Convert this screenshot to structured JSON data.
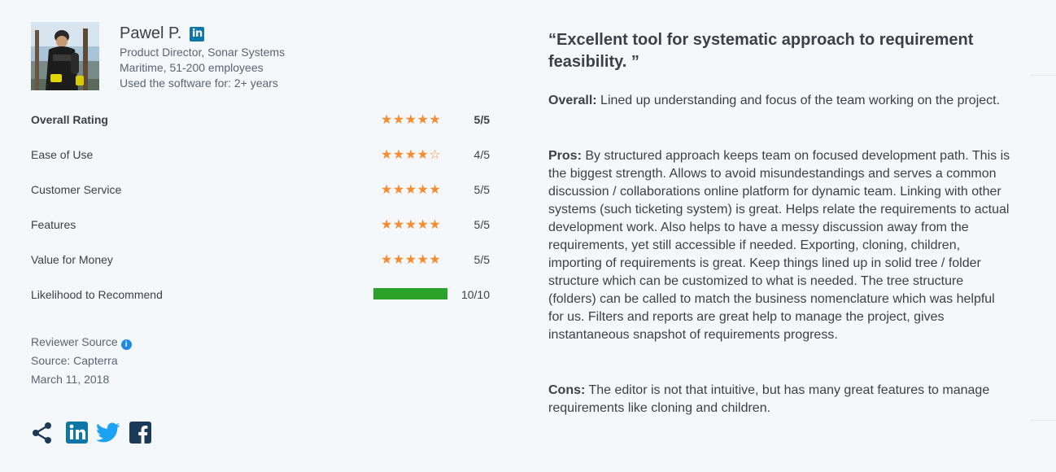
{
  "reviewer": {
    "name": "Pawel P.",
    "linkedin_badge": "in",
    "title": "Product Director, Sonar Systems",
    "industry": "Maritime, 51-200 employees",
    "usage": "Used the software for: 2+ years"
  },
  "ratings": [
    {
      "label": "Overall Rating",
      "score": "5/5",
      "stars": 5,
      "bold": true
    },
    {
      "label": "Ease of Use",
      "score": "4/5",
      "stars": 4
    },
    {
      "label": "Customer Service",
      "score": "5/5",
      "stars": 5
    },
    {
      "label": "Features",
      "score": "5/5",
      "stars": 5
    },
    {
      "label": "Value for Money",
      "score": "5/5",
      "stars": 5
    }
  ],
  "recommend": {
    "label": "Likelihood to Recommend",
    "score": "10/10",
    "fraction": 1.0,
    "bar_color": "#2ba32b"
  },
  "source": {
    "reviewer_source_label": "Reviewer Source",
    "source": "Source: Capterra",
    "date": "March 11, 2018"
  },
  "social_icons": [
    "share-icon",
    "linkedin-icon",
    "twitter-icon",
    "facebook-icon"
  ],
  "review": {
    "title": "“Excellent tool for systematic approach to requirement feasibility. ”",
    "overall_label": "Overall:",
    "overall_text": " Lined up understanding and focus of the team working on the project.",
    "pros_label": "Pros:",
    "pros_text": " By structured approach keeps team on focused development path. This is the biggest strength. Allows to avoid misundestandings and serves a common discussion / collaborations online platform for dynamic team. Linking with other systems (such ticketing system) is great. Helps relate the requirements to actual development work. Also helps to have a messy discussion away from the requirements, yet still accessible if needed. Exporting, cloning, children, importing of requirements is great. Keep things lined up in solid tree / folder structure which can be customized to what is needed. The tree structure (folders) can be called to match the business nomenclature which was helpful for us. Filters and reports are great help to manage the project, gives instantaneous snapshot of requirements progress.",
    "cons_label": "Cons:",
    "cons_text": " The editor is not that intuitive, but has many great features to manage requirements like cloning and children."
  },
  "colors": {
    "star": "#f68c2f",
    "linkedin": "#0e76a8",
    "twitter": "#1da1f2",
    "facebook": "#1b3a57",
    "info": "#1e88e5"
  }
}
